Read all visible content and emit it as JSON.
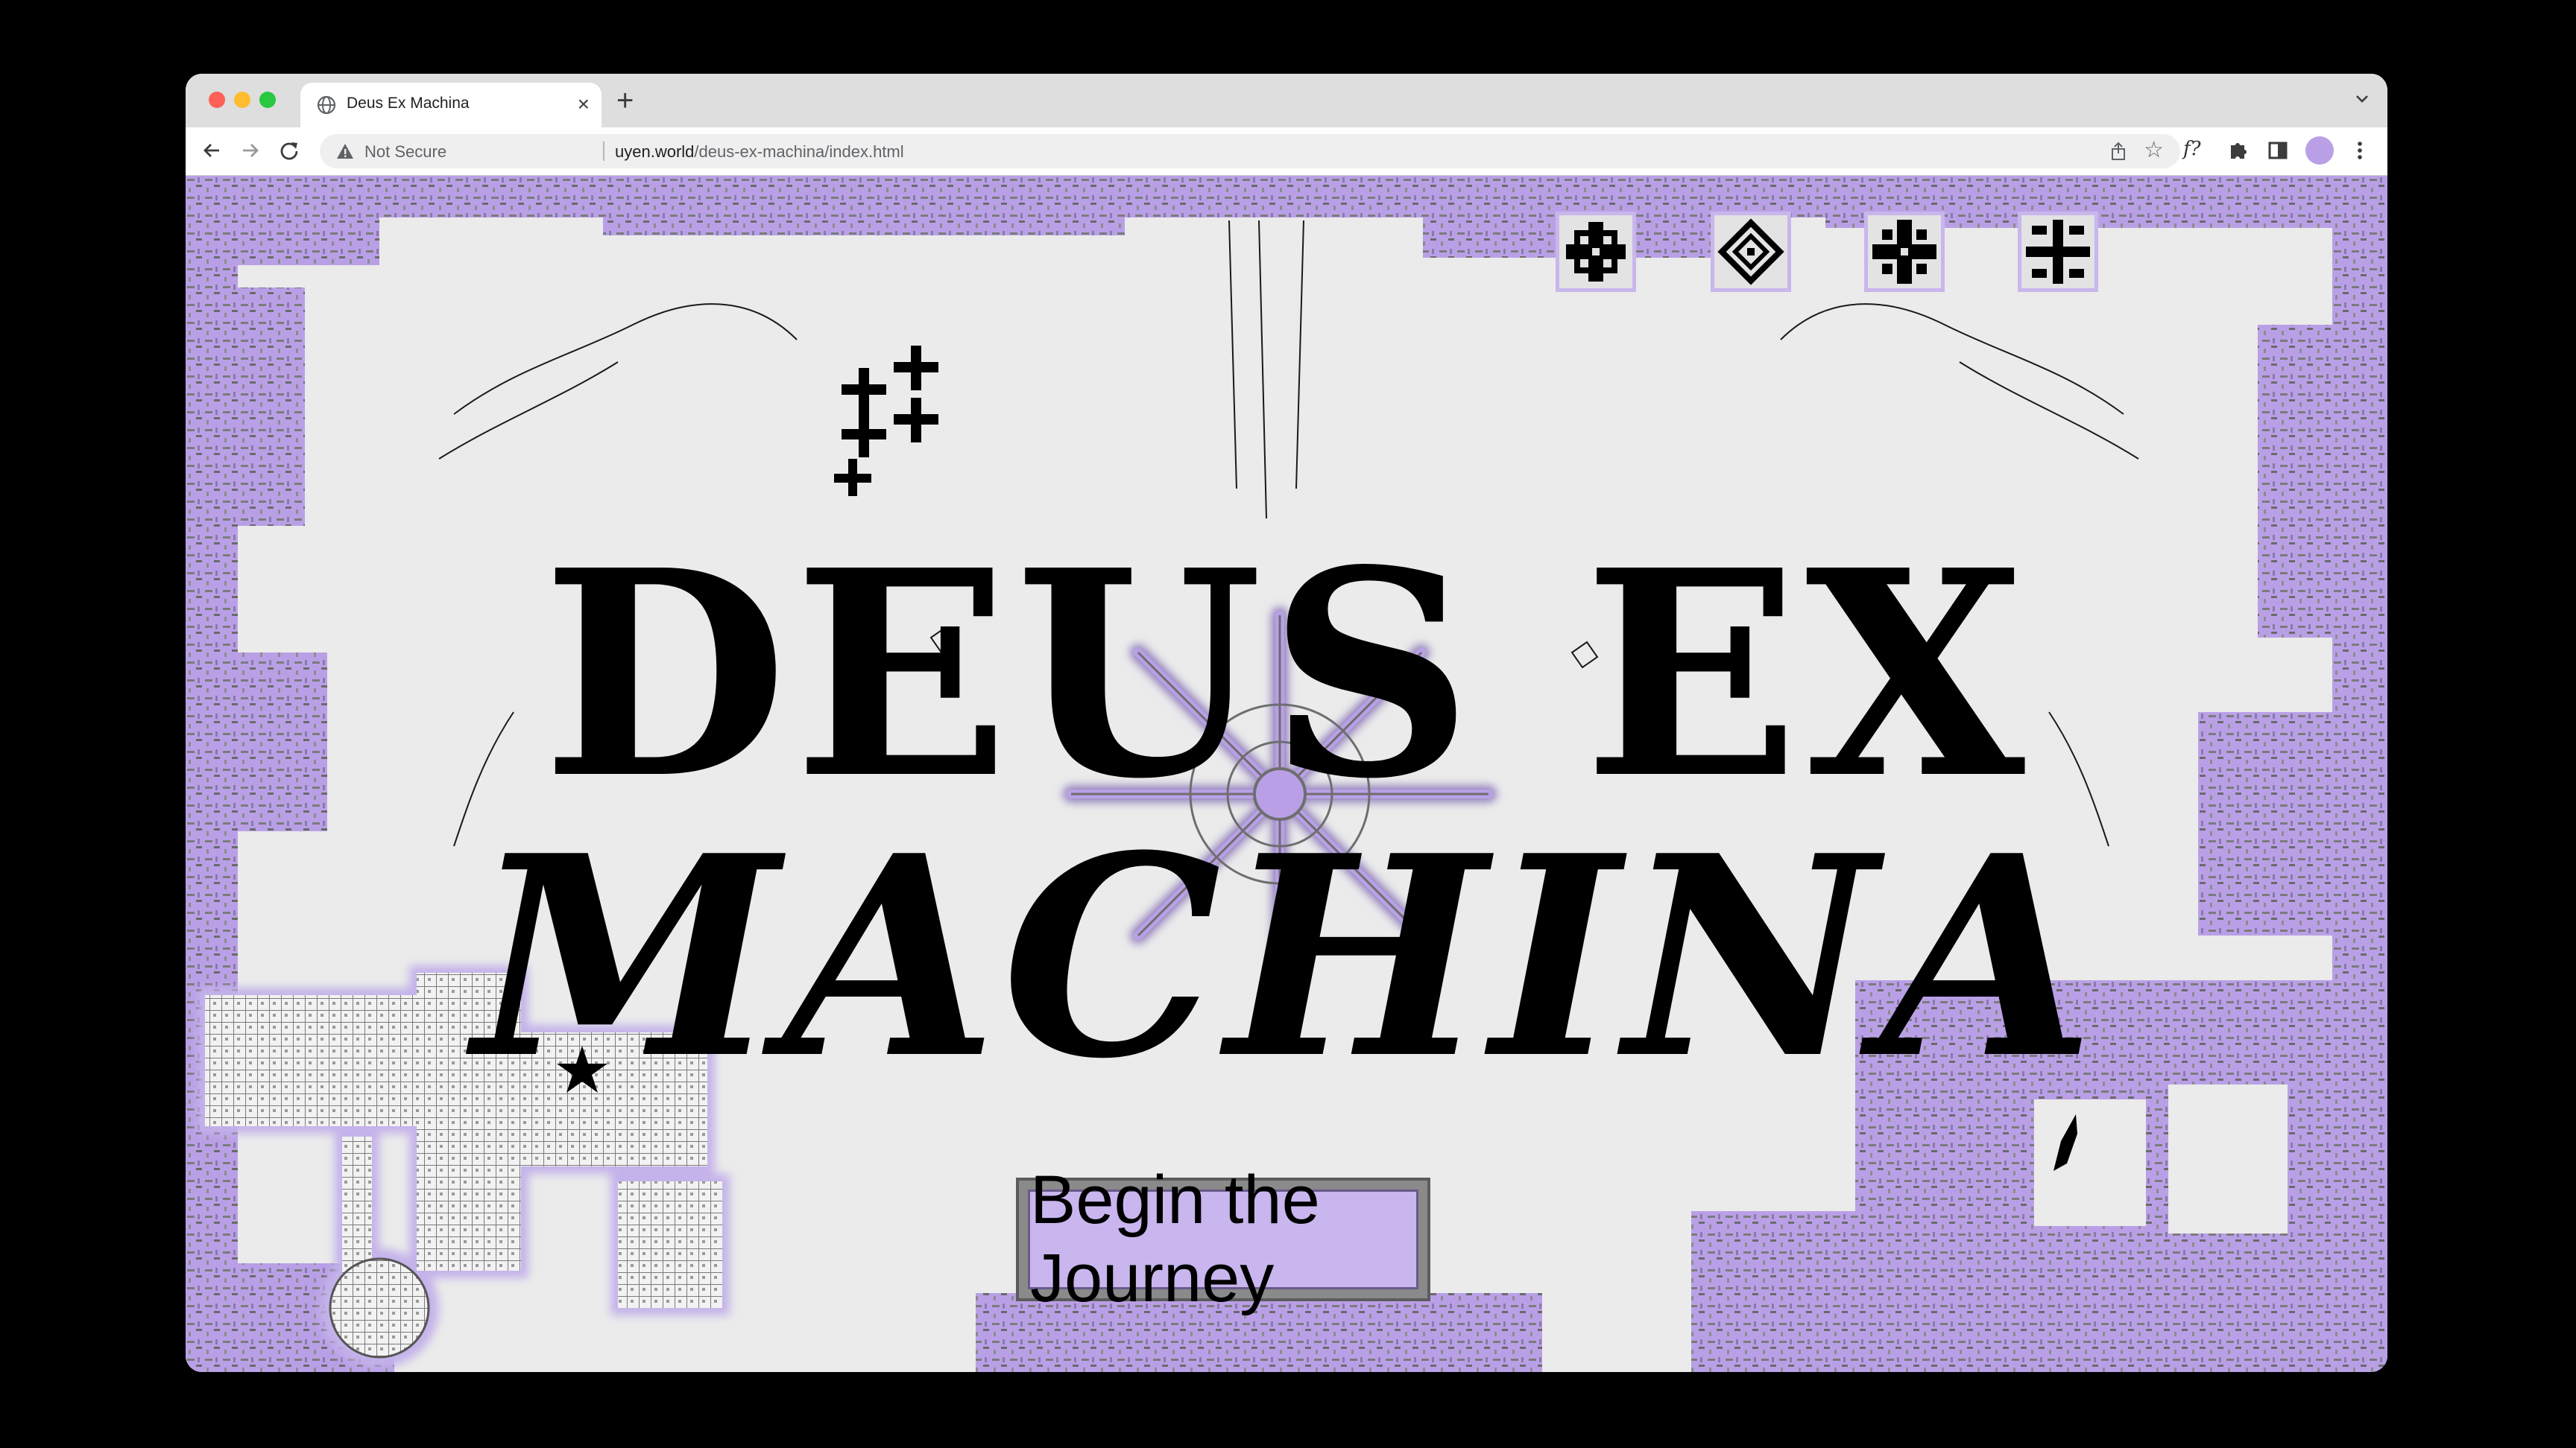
{
  "browser": {
    "tab_title": "Deus Ex Machina",
    "security_label": "Not Secure",
    "url_host": "uyen.world",
    "url_path": "/deus-ex-machina/index.html",
    "extension_f_label": "f?"
  },
  "page": {
    "headline_line1": "DEUS EX",
    "headline_line2": "MACHINA",
    "cta_label": "Begin the Journey",
    "colors": {
      "accent_lavender": "#b9a0e6",
      "accent_gray": "#8a8a8a",
      "text_black": "#000000",
      "background": "#ebebeb"
    },
    "top_icons": [
      "sigil-1-icon",
      "diamond-sigil-icon",
      "sigil-3-icon",
      "sigil-4-icon"
    ]
  }
}
